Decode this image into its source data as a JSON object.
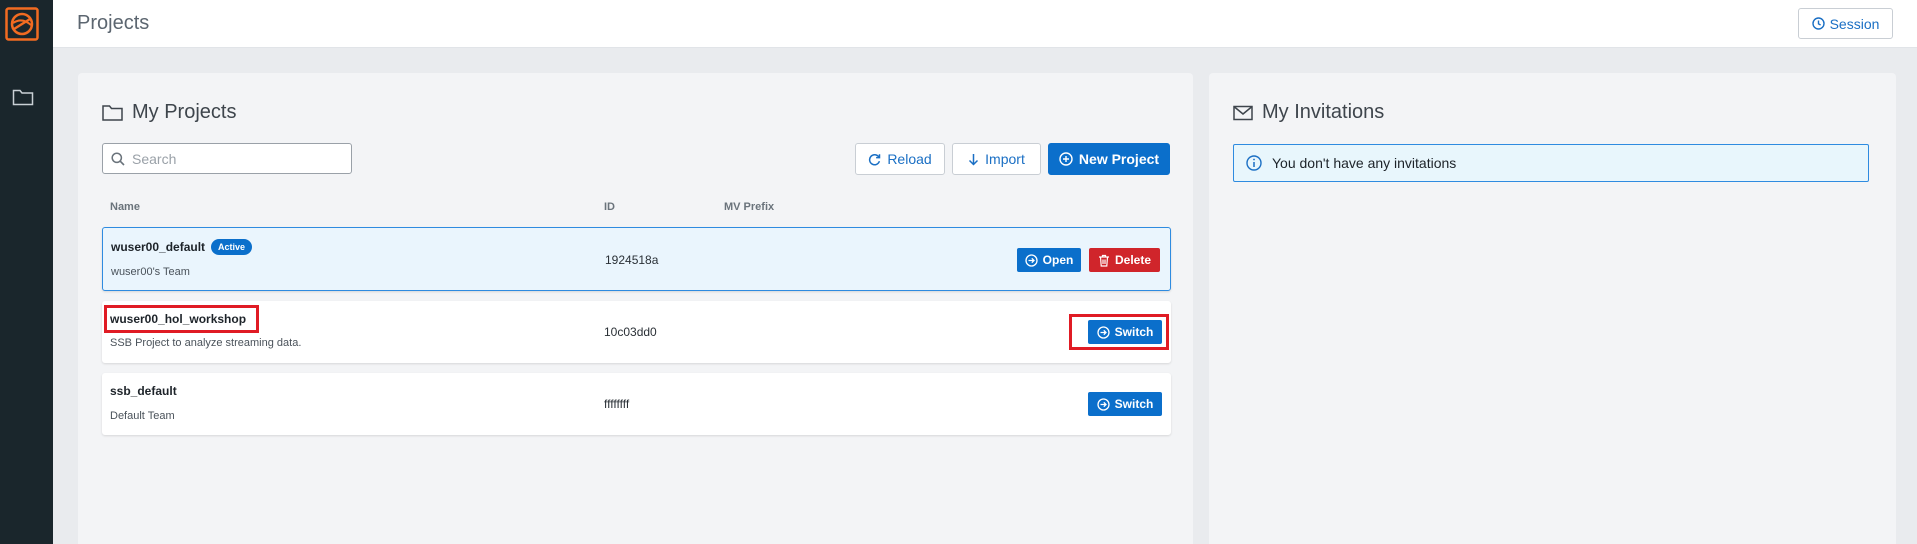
{
  "header": {
    "title": "Projects",
    "session_label": "Session"
  },
  "projects_panel": {
    "title": "My Projects",
    "search_placeholder": "Search",
    "reload_label": "Reload",
    "import_label": "Import",
    "new_project_label": "New Project",
    "columns": {
      "name": "Name",
      "id": "ID",
      "mv_prefix": "MV Prefix"
    },
    "rows": [
      {
        "name": "wuser00_default",
        "badge": "Active",
        "description": "wuser00's Team",
        "id": "1924518a",
        "mv_prefix": "",
        "open_label": "Open",
        "delete_label": "Delete"
      },
      {
        "name": "wuser00_hol_workshop",
        "description": "SSB Project to analyze streaming data.",
        "id": "10c03dd0",
        "mv_prefix": "",
        "switch_label": "Switch"
      },
      {
        "name": "ssb_default",
        "description": "Default Team",
        "id": "ffffffff",
        "mv_prefix": "",
        "switch_label": "Switch"
      }
    ]
  },
  "invitations_panel": {
    "title": "My Invitations",
    "empty_message": "You don't have any invitations"
  },
  "icons": {
    "logo": "logo-icon",
    "nav_projects": "folder-icon",
    "session": "clock-icon",
    "search": "search-icon",
    "reload": "reload-icon",
    "import": "arrow-down-icon",
    "new_project": "plus-circle-icon",
    "open": "arrow-circle-icon",
    "delete": "trash-icon",
    "switch": "arrow-circle-icon",
    "invitations": "envelope-icon",
    "info": "info-icon"
  },
  "colors": {
    "sidebar": "#1a262c",
    "logo_orange": "#f26b21",
    "primary": "#0b6fcb",
    "danger": "#d0252b",
    "highlight": "#e01b24"
  }
}
